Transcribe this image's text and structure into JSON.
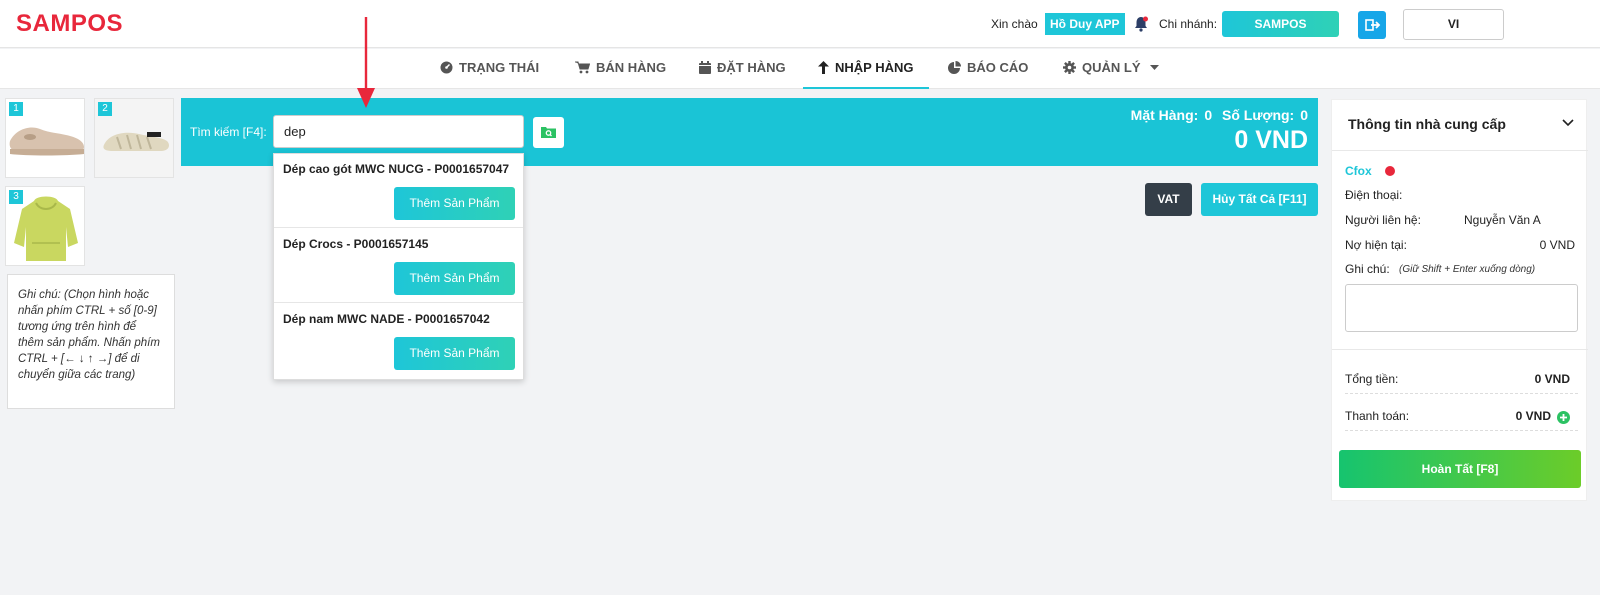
{
  "header": {
    "logo": "SAMPOS",
    "greeting": "Xin chào",
    "user_name": "Hồ Duy APP",
    "branch_label": "Chi nhánh:",
    "branch_name": "SAMPOS",
    "language": "VI"
  },
  "nav": {
    "items": [
      {
        "label": "TRẠNG THÁI",
        "icon": "dashboard-icon"
      },
      {
        "label": "BÁN HÀNG",
        "icon": "cart-icon"
      },
      {
        "label": "ĐẶT HÀNG",
        "icon": "calendar-icon"
      },
      {
        "label": "NHẬP HÀNG",
        "icon": "arrow-up-icon",
        "active": true
      },
      {
        "label": "BÁO CÁO",
        "icon": "pie-chart-icon"
      },
      {
        "label": "QUẢN LÝ",
        "icon": "gear-icon"
      }
    ]
  },
  "thumbnails": [
    {
      "num": "1",
      "icon": "shoe-icon"
    },
    {
      "num": "2",
      "icon": "sandal-icon"
    },
    {
      "num": "3",
      "icon": "hoodie-icon"
    }
  ],
  "note": "Ghi chú: (Chọn hình hoặc nhấn phím CTRL + số [0-9] tương ứng trên hình để thêm sản phẩm. Nhấn phím CTRL + [← ↓ ↑ →] để di chuyển giữa các trang)",
  "search": {
    "label": "Tìm kiếm [F4]:",
    "value": "dep",
    "totals_items_label": "Mặt Hàng:",
    "totals_items": "0",
    "totals_qty_label": "Số Lượng:",
    "totals_qty": "0",
    "total_amount": "0 VND"
  },
  "results": [
    {
      "name": "Dép cao gót MWC NUCG - P0001657047",
      "add_label": "Thêm Sản Phẩm"
    },
    {
      "name": "Dép Crocs - P0001657145",
      "add_label": "Thêm Sản Phẩm"
    },
    {
      "name": "Dép nam MWC NADE - P0001657042",
      "add_label": "Thêm Sản Phẩm"
    }
  ],
  "actions": {
    "vat": "VAT",
    "cancel_all": "Hủy Tất Cả [F11]"
  },
  "supplier_panel": {
    "title": "Thông tin nhà cung cấp",
    "supplier_name": "Cfox",
    "phone_label": "Điện thoại:",
    "contact_label": "Người liên hệ:",
    "contact_value": "Nguyễn Văn A",
    "debt_label": "Nợ hiện tại:",
    "debt_value": "0 VND",
    "note_label": "Ghi chú:",
    "note_hint": "(Giữ Shift + Enter xuống dòng)",
    "total_label": "Tổng tiền:",
    "total_value": "0 VND",
    "payment_label": "Thanh toán:",
    "payment_value": "0 VND",
    "done_label": "Hoàn Tất [F8]"
  },
  "colors": {
    "brand": "#e8273b",
    "accent": "#1ac4d6",
    "dark": "#343e48",
    "success": "#16c46f"
  }
}
